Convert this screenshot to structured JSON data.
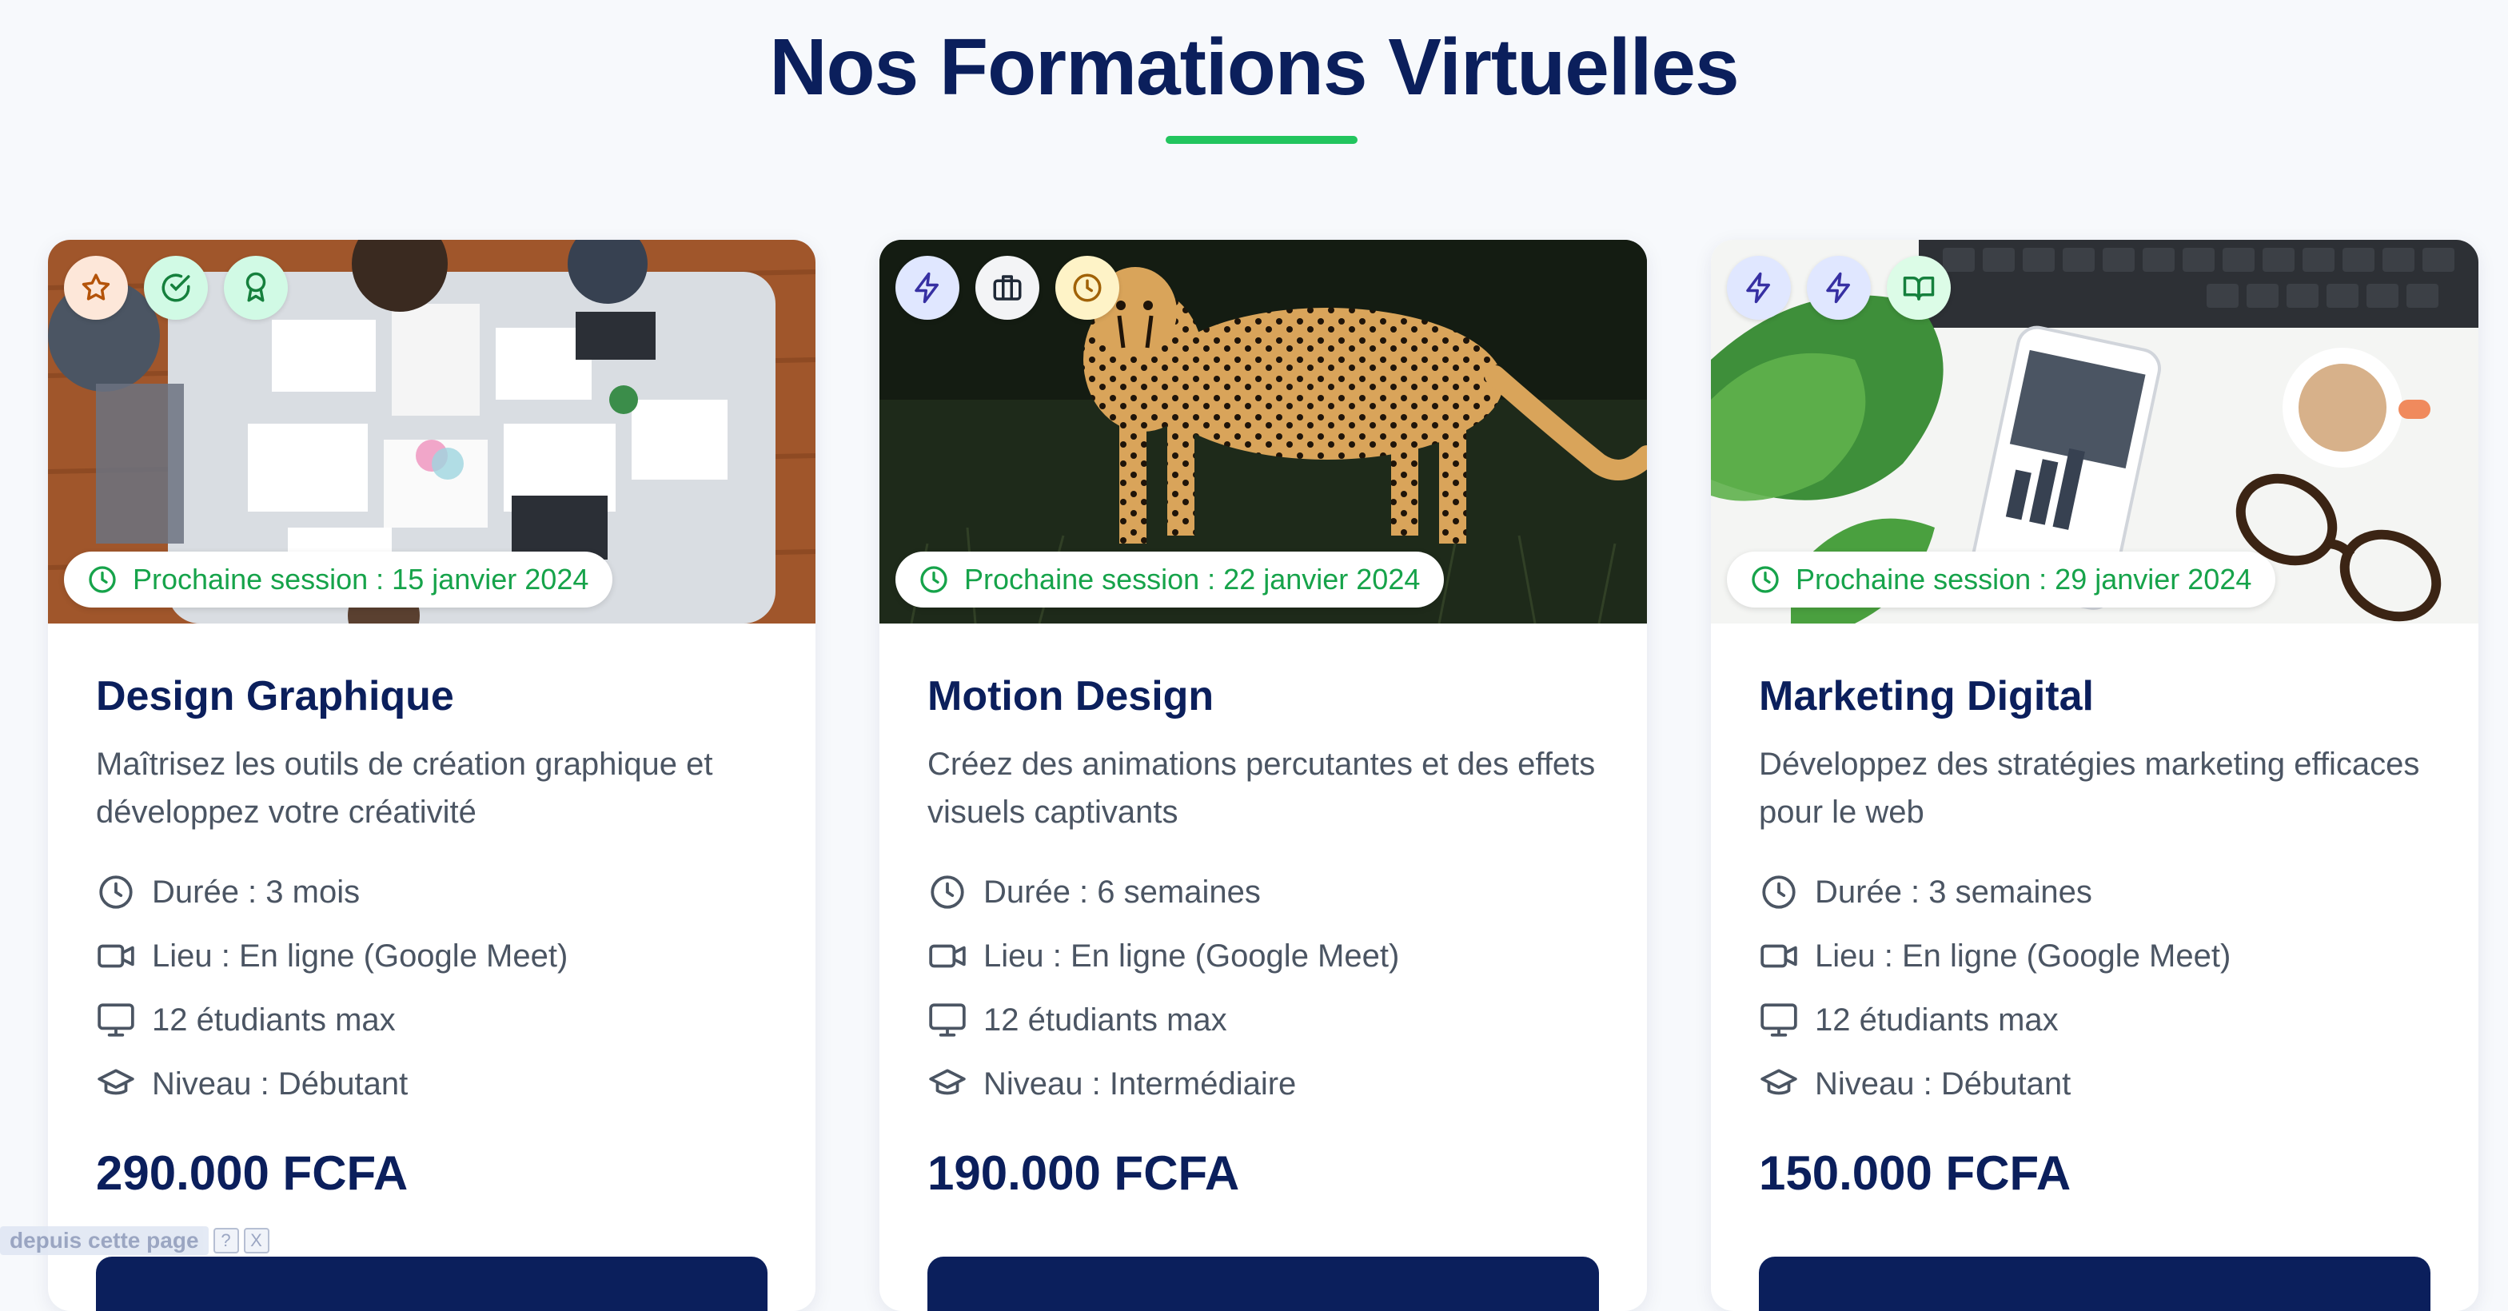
{
  "page": {
    "title": "Nos Formations Virtuelles",
    "accent_color": "#22c55e",
    "primary_color": "#0b1f5c"
  },
  "courses": [
    {
      "title": "Design Graphique",
      "description": "Maîtrisez les outils de création graphique et développez votre créativité",
      "session": "Prochaine session : 15 janvier 2024",
      "duration": "Durée : 3 mois",
      "location": "Lieu : En ligne (Google Meet)",
      "students": "12 étudiants max",
      "level": "Niveau : Débutant",
      "price": "290.000 FCFA",
      "badges": [
        "star-icon",
        "check-circle-icon",
        "award-icon"
      ],
      "image": "team-workspace-table-photo"
    },
    {
      "title": "Motion Design",
      "description": "Créez des animations percutantes et des effets visuels captivants",
      "session": "Prochaine session : 22 janvier 2024",
      "duration": "Durée : 6 semaines",
      "location": "Lieu : En ligne (Google Meet)",
      "students": "12 étudiants max",
      "level": "Niveau : Intermédiaire",
      "price": "190.000 FCFA",
      "badges": [
        "zap-icon",
        "briefcase-icon",
        "clock-icon"
      ],
      "image": "cheetah-photo"
    },
    {
      "title": "Marketing Digital",
      "description": "Développez des stratégies marketing efficaces pour le web",
      "session": "Prochaine session : 29 janvier 2024",
      "duration": "Durée : 3 semaines",
      "location": "Lieu : En ligne (Google Meet)",
      "students": "12 étudiants max",
      "level": "Niveau : Débutant",
      "price": "150.000 FCFA",
      "badges": [
        "zap-icon",
        "zap-icon",
        "book-open-icon"
      ],
      "image": "desk-phone-glasses-photo"
    }
  ],
  "widget": {
    "label": "depuis cette page",
    "help": "?",
    "close": "X"
  }
}
